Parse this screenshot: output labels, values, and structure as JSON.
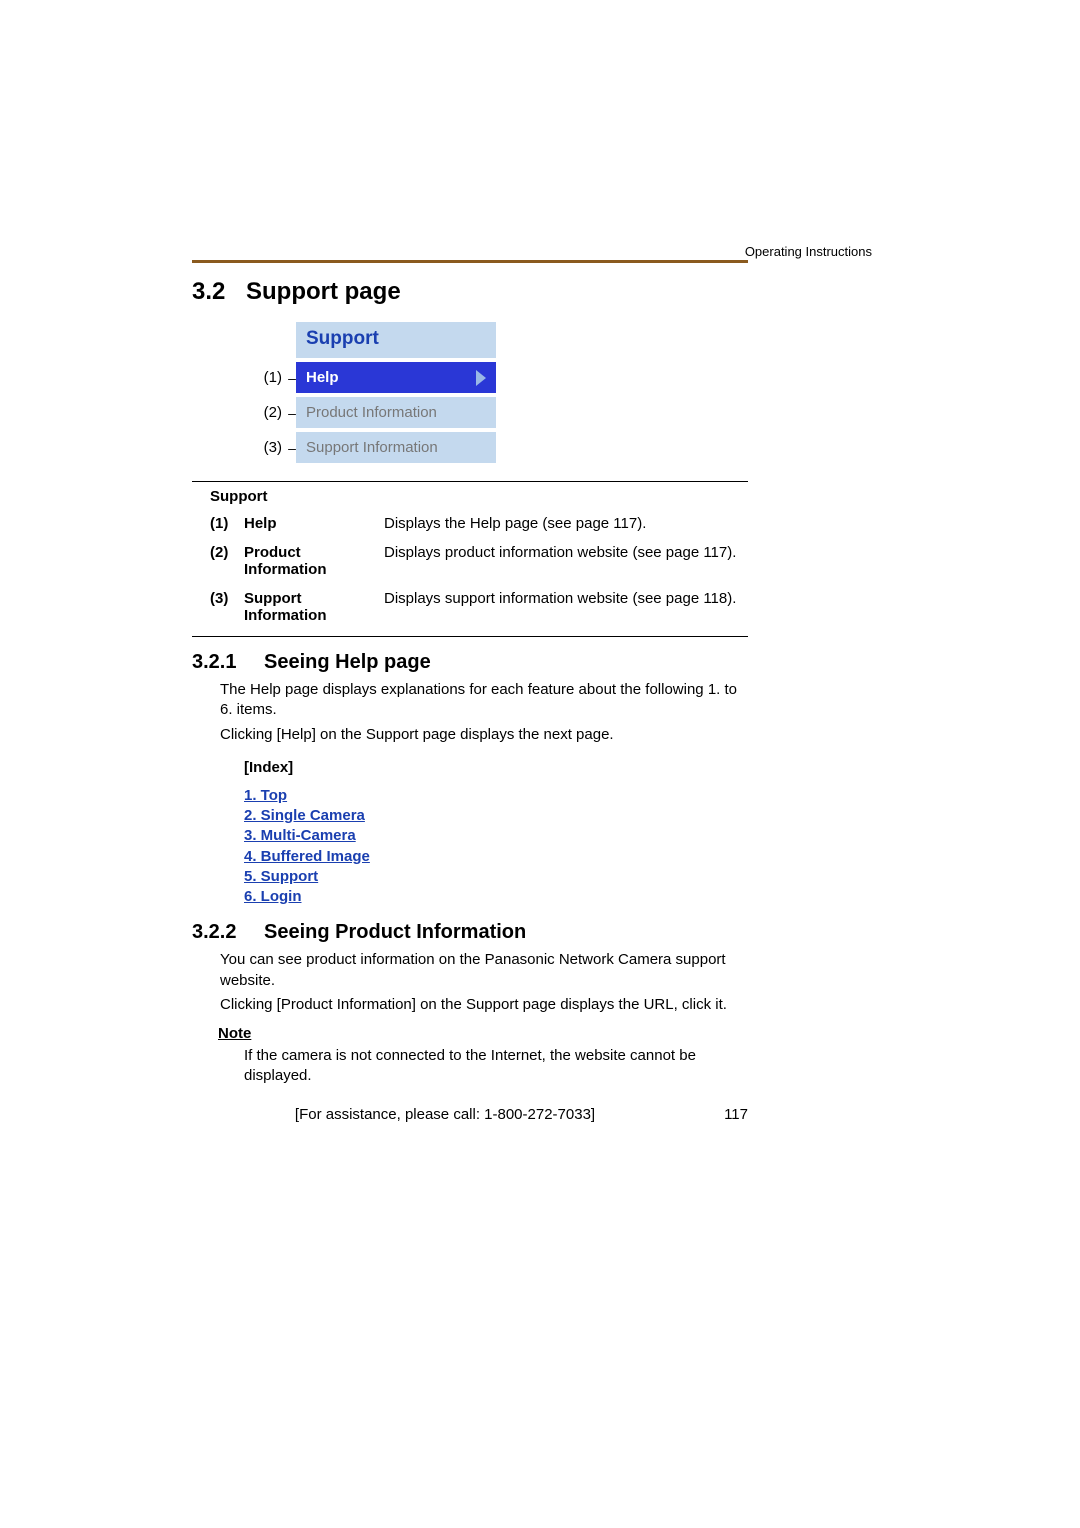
{
  "header": {
    "running": "Operating Instructions"
  },
  "section": {
    "number": "3.2",
    "title": "Support page"
  },
  "menu": {
    "title": "Support",
    "items": [
      {
        "marker": "(1)",
        "label": "Help",
        "active": true
      },
      {
        "marker": "(2)",
        "label": "Product Information",
        "active": false
      },
      {
        "marker": "(3)",
        "label": "Support Information",
        "active": false
      }
    ]
  },
  "defs": {
    "heading": "Support",
    "rows": [
      {
        "num": "(1)",
        "term": "Help",
        "desc": "Displays the Help page (see page 117)."
      },
      {
        "num": "(2)",
        "term": "Product Information",
        "desc": "Displays product information website (see page 117)."
      },
      {
        "num": "(3)",
        "term": "Support Information",
        "desc": "Displays support information website (see page 118)."
      }
    ]
  },
  "sub1": {
    "number": "3.2.1",
    "title": "Seeing Help page",
    "para1": "The Help page displays explanations for each feature about the following 1. to 6. items.",
    "para2": "Clicking [Help] on the Support page displays the next page."
  },
  "index": {
    "title": "[Index]",
    "links": [
      "1. Top",
      "2. Single Camera",
      "3. Multi-Camera",
      "4. Buffered Image",
      "5. Support",
      "6. Login"
    ]
  },
  "sub2": {
    "number": "3.2.2",
    "title": "Seeing Product Information",
    "para1": "You can see product information on the Panasonic Network Camera support website.",
    "para2": "Clicking [Product Information] on the Support page displays the URL, click it."
  },
  "note": {
    "heading": "Note",
    "body": "If the camera is not connected to the Internet, the website cannot be displayed."
  },
  "footer": {
    "assist": "[For assistance, please call: 1-800-272-7033]",
    "page": "117"
  }
}
